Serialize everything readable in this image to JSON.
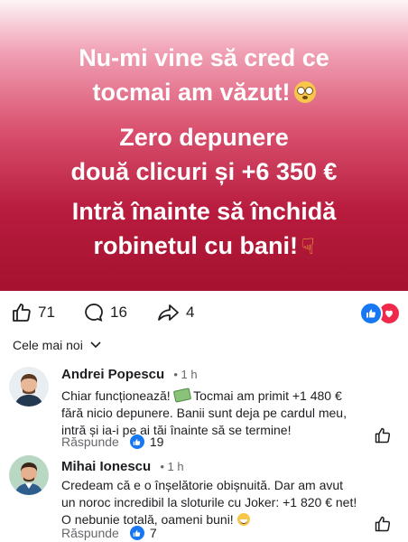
{
  "post": {
    "line1": "Nu-mi vine să cred ce",
    "line2": "tocmai am văzut!",
    "line3": "Zero depunere",
    "line4": "două clicuri și +6 350 €",
    "line5": "Intră înainte să închidă",
    "line6": "robinetul cu bani!",
    "emoji1": "flushed-face-emoji",
    "emoji2": "pointing-down-emoji"
  },
  "reactions": {
    "likes": "71",
    "comments": "16",
    "shares": "4",
    "badge_colors": {
      "like": "#1877f2",
      "love": "#f0284a"
    }
  },
  "sort": {
    "label": "Cele mai noi"
  },
  "comments": [
    {
      "author": "Andrei Popescu",
      "time": "1 h",
      "text_a": "Chiar funcționează!",
      "text_b": "Tocmai am primit +1 480 €",
      "text_line2": "fără nicio depunere. Banii sunt deja pe cardul meu,",
      "text_line3": "intră și ia-i pe ai tăi înainte să se termine!",
      "reply": "Răspunde",
      "likes": "19"
    },
    {
      "author": "Mihai Ionescu",
      "time": "1 h",
      "text_line1": "Credeam că e o înșelătorie obișnuită. Dar am avut",
      "text_line2": "un noroc incredibil la sloturile cu Joker: +1 820 € net!",
      "text_line3": "O nebunie totală, oameni buni!",
      "reply": "Răspunde",
      "likes": "7"
    }
  ]
}
